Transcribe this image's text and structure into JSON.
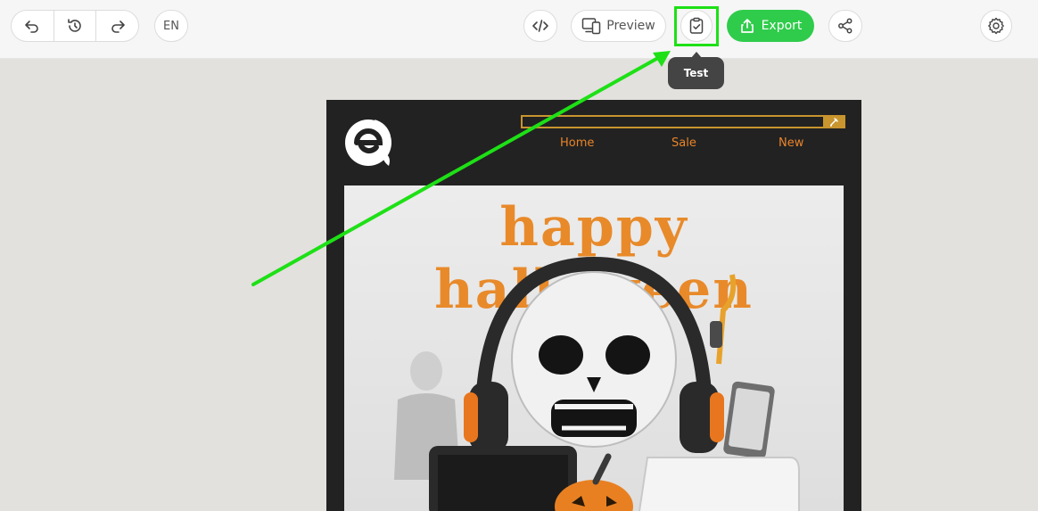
{
  "toolbar": {
    "language": "EN",
    "preview_label": "Preview",
    "export_label": "Export",
    "icons": {
      "undo": "undo-icon",
      "history": "history-icon",
      "redo": "redo-icon",
      "code": "code-icon",
      "devices": "devices-icon",
      "test": "clipboard-check-icon",
      "export": "upload-icon",
      "share": "share-icon",
      "settings": "gear-icon"
    }
  },
  "tooltip": {
    "text": "Test"
  },
  "email": {
    "nav": [
      {
        "label": "Home"
      },
      {
        "label": "Sale"
      },
      {
        "label": "New"
      }
    ],
    "hero_title": "happy halloween"
  },
  "colors": {
    "export_green": "#2fcc4b",
    "highlight_green": "#1ee016",
    "email_bg": "#222222",
    "accent_orange": "#e9842a",
    "search_border": "#c8952e"
  }
}
